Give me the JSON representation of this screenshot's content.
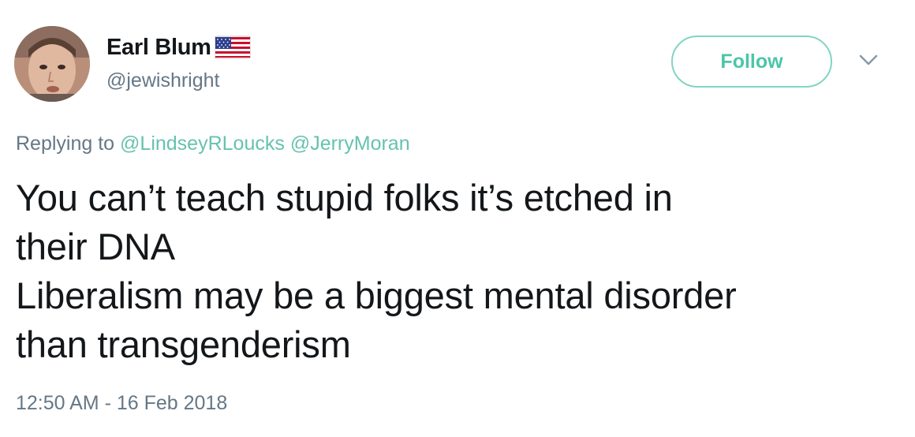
{
  "user": {
    "display_name": "Earl Blum",
    "handle": "@jewishright",
    "flag_icon": "us-flag-icon"
  },
  "actions": {
    "follow_label": "Follow",
    "more_icon": "chevron-down-icon"
  },
  "reply": {
    "prefix": "Replying to",
    "mentions": [
      "@LindseyRLoucks",
      "@JerryMoran"
    ]
  },
  "tweet": {
    "lines": [
      "You can’t teach stupid folks it’s etched in",
      "their DNA",
      "Liberalism may be a biggest mental disorder",
      "than transgenderism"
    ],
    "timestamp": "12:50 AM - 16 Feb 2018"
  },
  "colors": {
    "accent": "#4cc5a8",
    "text": "#14171a",
    "secondary": "#657786"
  }
}
